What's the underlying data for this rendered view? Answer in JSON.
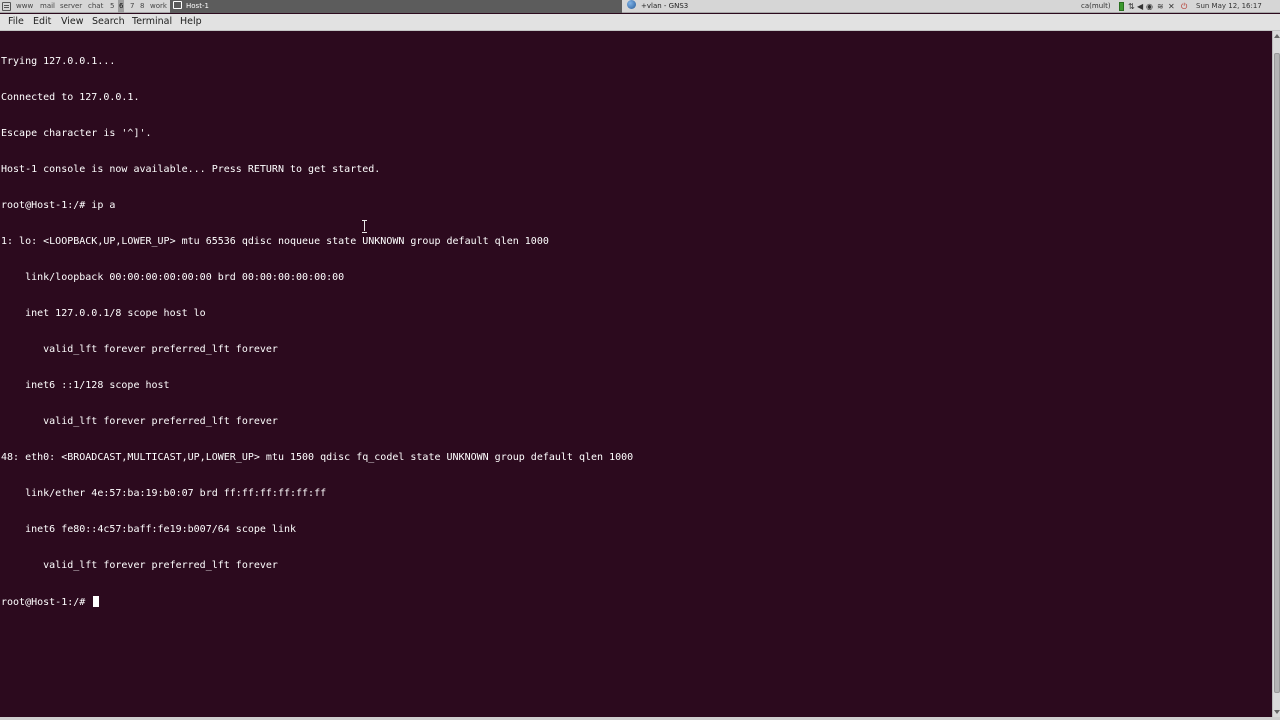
{
  "panel": {
    "workspaces": [
      "www",
      "mail",
      "server",
      "chat",
      "5",
      "6",
      "7",
      "8",
      "work"
    ],
    "active_workspace": "6",
    "tasks": [
      {
        "label": "Host-1",
        "active": true
      },
      {
        "label": "+vlan - GNS3",
        "active": false
      }
    ],
    "tray": {
      "label": "ca(mult)",
      "clock": "Sun May 12, 16:17"
    }
  },
  "menubar": {
    "items": [
      "File",
      "Edit",
      "View",
      "Search",
      "Terminal",
      "Help"
    ]
  },
  "terminal": {
    "lines": [
      "Trying 127.0.0.1...",
      "Connected to 127.0.0.1.",
      "Escape character is '^]'.",
      "Host-1 console is now available... Press RETURN to get started.",
      "root@Host-1:/# ip a",
      "1: lo: <LOOPBACK,UP,LOWER_UP> mtu 65536 qdisc noqueue state UNKNOWN group default qlen 1000",
      "    link/loopback 00:00:00:00:00:00 brd 00:00:00:00:00:00",
      "    inet 127.0.0.1/8 scope host lo",
      "       valid_lft forever preferred_lft forever",
      "    inet6 ::1/128 scope host",
      "       valid_lft forever preferred_lft forever",
      "48: eth0: <BROADCAST,MULTICAST,UP,LOWER_UP> mtu 1500 qdisc fq_codel state UNKNOWN group default qlen 1000",
      "    link/ether 4e:57:ba:19:b0:07 brd ff:ff:ff:ff:ff:ff",
      "    inet6 fe80::4c57:baff:fe19:b007/64 scope link",
      "       valid_lft forever preferred_lft forever"
    ],
    "prompt": "root@Host-1:/# "
  },
  "colors": {
    "terminal_bg": "#2c0a1e",
    "terminal_fg": "#ffffff",
    "panel_bg": "#d6d6d6",
    "menubar_bg": "#e2e2e2"
  }
}
